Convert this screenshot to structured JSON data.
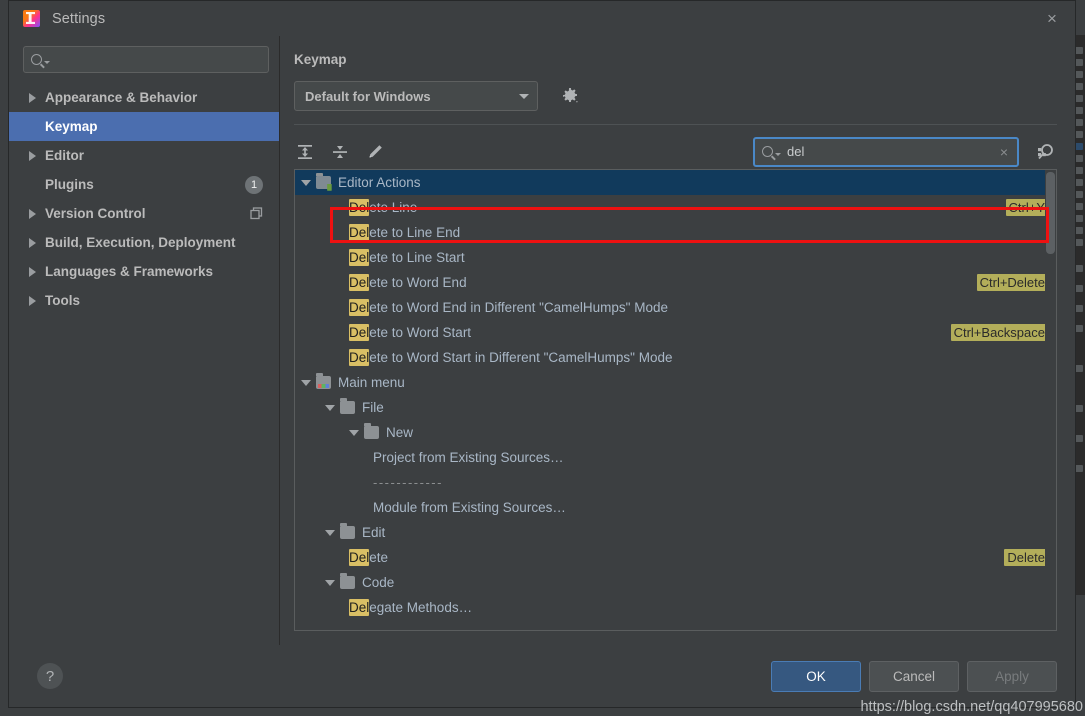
{
  "window": {
    "title": "Settings",
    "app_icon": "intellij-logo-icon",
    "close_label": "×"
  },
  "sidebar": {
    "search": {
      "value": "",
      "placeholder": ""
    },
    "items": [
      {
        "label": "Appearance & Behavior",
        "expandable": true,
        "selected": false,
        "badge": null,
        "trailing_icon": null
      },
      {
        "label": "Keymap",
        "expandable": false,
        "selected": true,
        "badge": null,
        "trailing_icon": null
      },
      {
        "label": "Editor",
        "expandable": true,
        "selected": false,
        "badge": null,
        "trailing_icon": null
      },
      {
        "label": "Plugins",
        "expandable": false,
        "selected": false,
        "badge": "1",
        "trailing_icon": null
      },
      {
        "label": "Version Control",
        "expandable": true,
        "selected": false,
        "badge": null,
        "trailing_icon": "copy-icon"
      },
      {
        "label": "Build, Execution, Deployment",
        "expandable": true,
        "selected": false,
        "badge": null,
        "trailing_icon": null
      },
      {
        "label": "Languages & Frameworks",
        "expandable": true,
        "selected": false,
        "badge": null,
        "trailing_icon": null
      },
      {
        "label": "Tools",
        "expandable": true,
        "selected": false,
        "badge": null,
        "trailing_icon": null
      }
    ]
  },
  "content": {
    "header": "Keymap",
    "keymap_select": {
      "value": "Default for Windows"
    },
    "gear_icon": "gear-icon",
    "toolbar": {
      "expand_all_icon": "expand-all-icon",
      "collapse_all_icon": "collapse-all-icon",
      "edit_shortcut_icon": "pencil-edit-icon"
    },
    "tree_search": {
      "value": "del",
      "placeholder": "",
      "clear_label": "×"
    },
    "filter_icon": "find-shortcut-icon"
  },
  "tree": {
    "highlight_term": "Del",
    "rows": [
      {
        "indent": 0,
        "type": "group",
        "arrow": "down",
        "icon": "editor-actions-folder-icon",
        "label": "Editor Actions",
        "selected": true,
        "shortcut": null
      },
      {
        "indent": 2,
        "type": "action",
        "arrow": null,
        "icon": null,
        "label": "Delete Line",
        "selected": false,
        "shortcut": "Ctrl+Y"
      },
      {
        "indent": 2,
        "type": "action",
        "arrow": null,
        "icon": null,
        "label": "Delete to Line End",
        "selected": false,
        "shortcut": null
      },
      {
        "indent": 2,
        "type": "action",
        "arrow": null,
        "icon": null,
        "label": "Delete to Line Start",
        "selected": false,
        "shortcut": null
      },
      {
        "indent": 2,
        "type": "action",
        "arrow": null,
        "icon": null,
        "label": "Delete to Word End",
        "selected": false,
        "shortcut": "Ctrl+Delete"
      },
      {
        "indent": 2,
        "type": "action",
        "arrow": null,
        "icon": null,
        "label": "Delete to Word End in Different \"CamelHumps\" Mode",
        "selected": false,
        "shortcut": null
      },
      {
        "indent": 2,
        "type": "action",
        "arrow": null,
        "icon": null,
        "label": "Delete to Word Start",
        "selected": false,
        "shortcut": "Ctrl+Backspace"
      },
      {
        "indent": 2,
        "type": "action",
        "arrow": null,
        "icon": null,
        "label": "Delete to Word Start in Different \"CamelHumps\" Mode",
        "selected": false,
        "shortcut": null
      },
      {
        "indent": 0,
        "type": "group",
        "arrow": "down",
        "icon": "main-menu-folder-icon",
        "label": "Main menu",
        "selected": false,
        "shortcut": null
      },
      {
        "indent": 1,
        "type": "group",
        "arrow": "down",
        "icon": "folder-icon",
        "label": "File",
        "selected": false,
        "shortcut": null
      },
      {
        "indent": 2,
        "type": "group",
        "arrow": "down",
        "icon": "folder-icon",
        "label": "New",
        "selected": false,
        "shortcut": null
      },
      {
        "indent": 3,
        "type": "action",
        "arrow": null,
        "icon": null,
        "label": "Project from Existing Sources…",
        "selected": false,
        "shortcut": null
      },
      {
        "indent": 3,
        "type": "separator",
        "arrow": null,
        "icon": null,
        "label": "------------",
        "selected": false,
        "shortcut": null
      },
      {
        "indent": 3,
        "type": "action",
        "arrow": null,
        "icon": null,
        "label": "Module from Existing Sources…",
        "selected": false,
        "shortcut": null
      },
      {
        "indent": 1,
        "type": "group",
        "arrow": "down",
        "icon": "folder-icon",
        "label": "Edit",
        "selected": false,
        "shortcut": null
      },
      {
        "indent": 2,
        "type": "action",
        "arrow": null,
        "icon": null,
        "label": "Delete",
        "selected": false,
        "shortcut": "Delete"
      },
      {
        "indent": 1,
        "type": "group",
        "arrow": "down",
        "icon": "folder-icon",
        "label": "Code",
        "selected": false,
        "shortcut": null
      },
      {
        "indent": 2,
        "type": "action",
        "arrow": null,
        "icon": null,
        "label": "Delegate Methods…",
        "selected": false,
        "shortcut": null
      }
    ]
  },
  "footer": {
    "help_label": "?",
    "ok_label": "OK",
    "cancel_label": "Cancel",
    "apply_label": "Apply"
  },
  "watermark": {
    "text": "https://blog.csdn.net/qq407995680"
  },
  "colors": {
    "accent": "#4b6eaf",
    "primary_button": "#365880",
    "search_focus_border": "#4a88c7",
    "match_highlight": "#d9bf65",
    "shortcut_highlight": "#b3ae5a",
    "tree_selection": "#113a5c",
    "annotation": "#ee1111"
  }
}
